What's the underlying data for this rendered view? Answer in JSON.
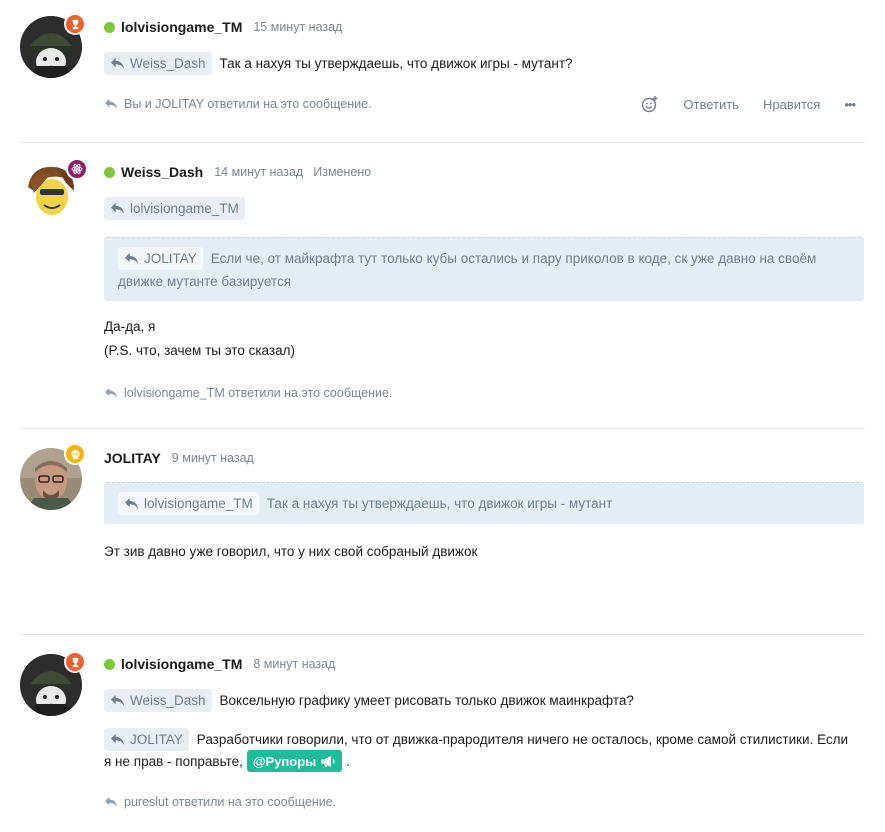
{
  "posts": [
    {
      "username": "lolvisiongame_TM",
      "time": "15 минут назад",
      "reply_to": "Weiss_Dash",
      "text": "Так а нахуя ты утверждаешь, что движок игры - мутант?",
      "replied_note": "Вы и JOLITAY ответили на это сообщение.",
      "actions": {
        "reply": "Ответить",
        "like": "Нравится",
        "more": "•••"
      },
      "badge_color": "#f0622d"
    },
    {
      "username": "Weiss_Dash",
      "time": "14 минут назад",
      "edited": "Изменено",
      "reply_to": "lolvisiongame_TM",
      "quote_author": "JOLITAY",
      "quote_line1": "Если че, от майкрафта тут только кубы остались и пару приколов в коде, ск уже давно на своём",
      "quote_line2": "движке мутанте базируется",
      "text_line1": "Да-да, я",
      "text_line2": "(P.S. что, зачем ты это сказал)",
      "replied_note": "lolvisiongame_TM ответили на это сообщение.",
      "badge_color": "#8a1f6b"
    },
    {
      "username": "JOLITAY",
      "time": "9 минут назад",
      "quote_author": "lolvisiongame_TM",
      "quote_text": "Так а нахуя ты утверждаешь, что движок игры - мутант",
      "text": "Эт зив давно уже говорил, что у них свой собраный движок",
      "badge_color": "#f2b705"
    },
    {
      "username": "lolvisiongame_TM",
      "time": "8 минут назад",
      "reply1_to": "Weiss_Dash",
      "reply1_text": "Воксельную графику умеет рисовать только движок маинкрафта?",
      "reply2_to": "JOLITAY",
      "reply2_line1": "Разработчики говорили, что от движка-прародителя ничего не осталось, кроме самой стилистики. Если",
      "reply2_line2_pre": "я не прав - поправьте,",
      "tag": "@Рупоры",
      "reply2_line2_post": ".",
      "replied_note": "pureslut ответили на это сообщение.",
      "badge_color": "#f0622d"
    }
  ]
}
